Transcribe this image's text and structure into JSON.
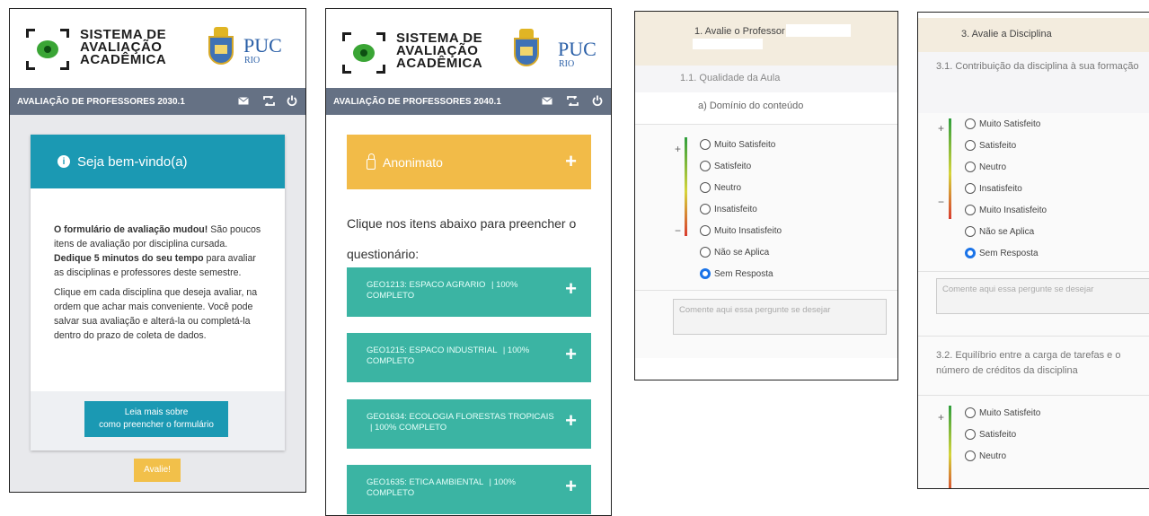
{
  "brand": {
    "system_line1": "SISTEMA DE",
    "system_line2": "AVALIAÇÃO",
    "system_line3": "ACADÊMICA",
    "puc": "PUC",
    "rio": "RIO"
  },
  "panel1": {
    "title": "AVALIAÇÃO DE PROFESSORES 2030.1",
    "welcome": "Seja bem-vindo(a)",
    "p1_bold": "O formulário de avaliação mudou!",
    "p1_a": " São poucos itens de avaliação por disciplina cursada. ",
    "p1_bold2": "Dedique 5 minutos do seu tempo",
    "p1_b": " para avaliar as disciplinas e professores deste semestre.",
    "p2": "Clique em cada disciplina que deseja avaliar, na ordem que achar mais conveniente. Você pode salvar sua avaliação e alterá-la ou completá-la dentro do prazo de coleta de dados.",
    "read_line1": "Leia mais sobre",
    "read_line2": "como preencher o formulário",
    "avaliar": "Avalie!"
  },
  "panel2": {
    "title": "AVALIAÇÃO DE PROFESSORES 2040.1",
    "anon": "Anonimato",
    "intro": "Clique nos itens abaixo para preencher o questionário:",
    "disciplines": [
      {
        "name": "GEO1213: ESPACO AGRARIO",
        "status": "| 100% COMPLETO"
      },
      {
        "name": "GEO1215: ESPACO INDUSTRIAL",
        "status": "| 100% COMPLETO"
      },
      {
        "name": "GEO1634: ECOLOGIA FLORESTAS TROPICAIS",
        "status": "| 100% COMPLETO"
      },
      {
        "name": "GEO1635: ETICA AMBIENTAL",
        "status": "| 100% COMPLETO"
      }
    ]
  },
  "panel3": {
    "section": "1. Avalie o Professor",
    "sub": "1.1. Qualidade da Aula",
    "item": "a) Domínio do conteúdo",
    "options": [
      "Muito Satisfeito",
      "Satisfeito",
      "Neutro",
      "Insatisfeito",
      "Muito Insatisfeito",
      "Não se Aplica",
      "Sem Resposta"
    ],
    "selected": 6,
    "comment_placeholder": "Comente aqui essa pergunte se desejar"
  },
  "panel4": {
    "section": "3. Avalie a Disciplina",
    "q1": "3.1. Contribuição da disciplina à sua formação",
    "options": [
      "Muito Satisfeito",
      "Satisfeito",
      "Neutro",
      "Insatisfeito",
      "Muito Insatisfeito",
      "Não se Aplica",
      "Sem Resposta"
    ],
    "selected": 6,
    "comment_placeholder": "Comente aqui essa pergunte se desejar",
    "q2": "3.2. Equilíbrio entre a carga de tarefas e o número de créditos da disciplina",
    "options2": [
      "Muito Satisfeito",
      "Satisfeito",
      "Neutro"
    ]
  },
  "scale": {
    "plus": "+",
    "minus": "−"
  },
  "icons": {
    "plus": "+",
    "info": "i"
  },
  "colors": {
    "header": "#657184",
    "teal": "#3bb4a3",
    "blue": "#1b99b3",
    "amber": "#f2bb48"
  }
}
